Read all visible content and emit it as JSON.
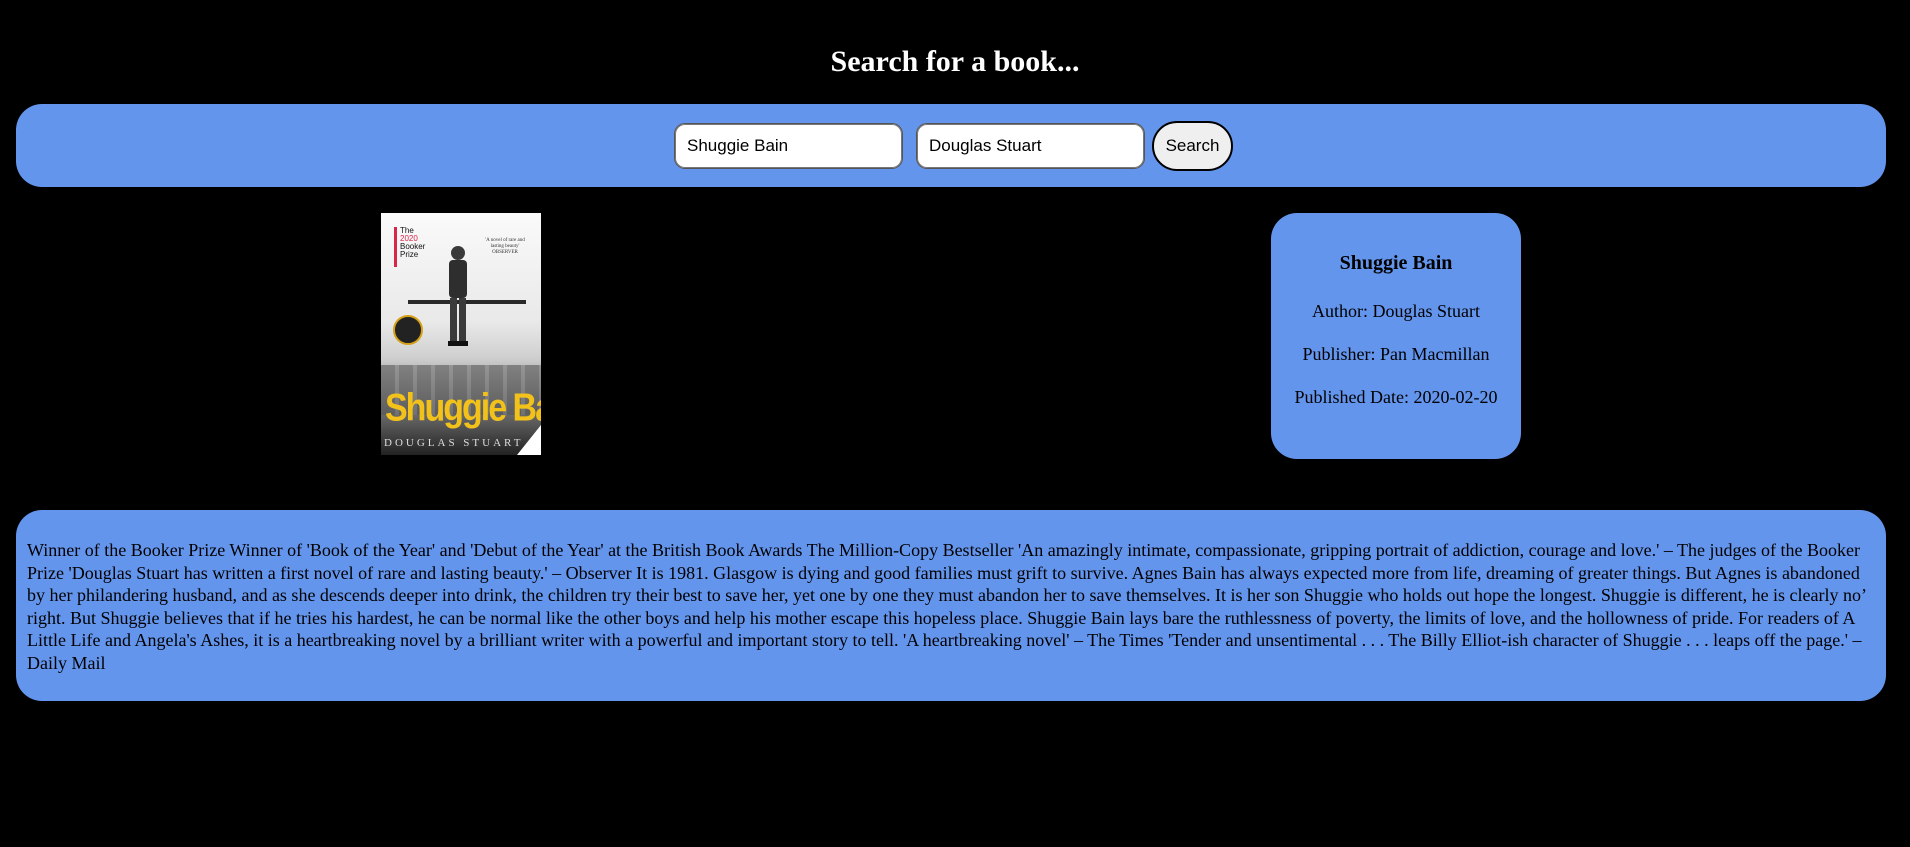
{
  "header": {
    "title": "Search for a book..."
  },
  "search": {
    "title_value": "Shuggie Bain",
    "author_value": "Douglas Stuart",
    "button_label": "Search"
  },
  "book": {
    "cover": {
      "title": "Shuggie Bain",
      "author": "DOUGLAS STUART",
      "badge_line1": "The",
      "badge_year": "2020",
      "badge_line2": "Booker",
      "badge_line3": "Prize",
      "quote": "'A novel of rare and lasting beauty' OBSERVER"
    },
    "title": "Shuggie Bain",
    "author_line": "Author: Douglas Stuart",
    "publisher_line": "Publisher: Pan Macmillan",
    "date_line": "Published Date: 2020-02-20",
    "description": "Winner of the Booker Prize Winner of 'Book of the Year' and 'Debut of the Year' at the British Book Awards The Million-Copy Bestseller 'An amazingly intimate, compassionate, gripping portrait of addiction, courage and love.' – The judges of the Booker Prize 'Douglas Stuart has written a first novel of rare and lasting beauty.' – Observer It is 1981. Glasgow is dying and good families must grift to survive. Agnes Bain has always expected more from life, dreaming of greater things. But Agnes is abandoned by her philandering husband, and as she descends deeper into drink, the children try their best to save her, yet one by one they must abandon her to save themselves. It is her son Shuggie who holds out hope the longest. Shuggie is different, he is clearly no’ right. But Shuggie believes that if he tries his hardest, he can be normal like the other boys and help his mother escape this hopeless place. Shuggie Bain lays bare the ruthlessness of poverty, the limits of love, and the hollowness of pride. For readers of A Little Life and Angela's Ashes, it is a heartbreaking novel by a brilliant writer with a powerful and important story to tell. 'A heartbreaking novel' – The Times 'Tender and unsentimental . . . The Billy Elliot-ish character of Shuggie . . . leaps off the page.' – Daily Mail"
  },
  "colors": {
    "background": "#000000",
    "panel": "#6495ED",
    "title_text": "#ffffff",
    "cover_title": "#f2c21b"
  }
}
